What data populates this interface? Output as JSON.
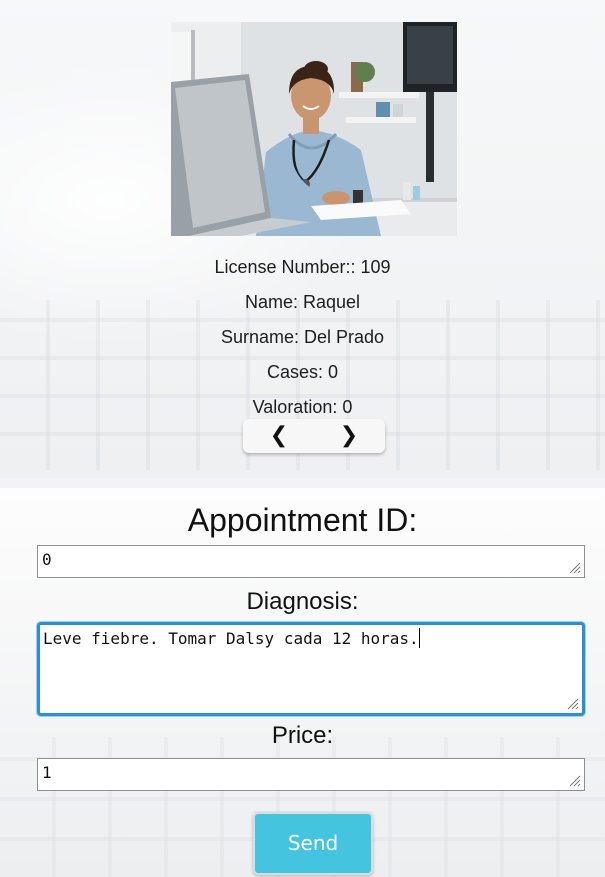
{
  "doctor": {
    "photo_alt": "doctor-photo",
    "license_line": "License Number:: 109",
    "name_line": "Name: Raquel",
    "surname_line": "Surname: Del Prado",
    "cases_line": "Cases: 0",
    "valoration_line": "Valoration: 0",
    "prev_label": "❮",
    "next_label": "❯"
  },
  "form": {
    "appointment_label": "Appointment ID:",
    "appointment_value": "0",
    "diagnosis_label": "Diagnosis:",
    "diagnosis_value": "Leve fiebre. Tomar Dalsy cada 12 horas.",
    "price_label": "Price:",
    "price_value": "1",
    "send_label": "Send"
  },
  "colors": {
    "send_button": "#45c4df",
    "focus_border": "#2b8fd4"
  }
}
